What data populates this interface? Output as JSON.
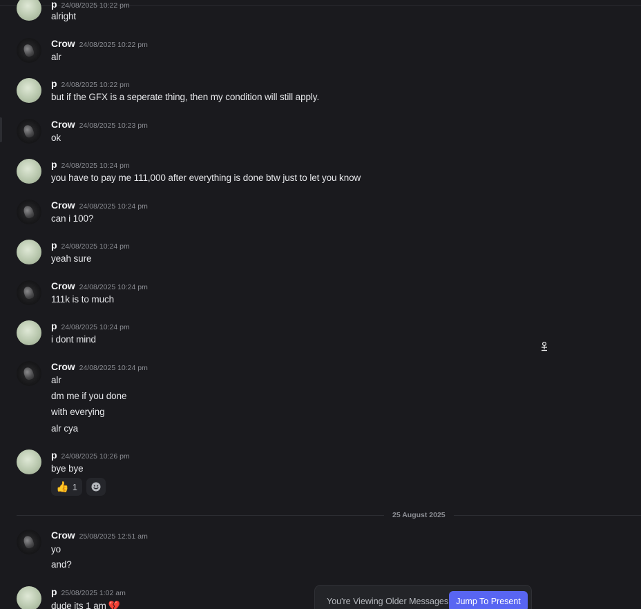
{
  "colors": {
    "background": "#1a1a1e",
    "accent": "#5865f2",
    "author_text": "#f2f3f5",
    "timestamp_text": "#8b8d93"
  },
  "messages": [
    {
      "author": "p",
      "timestamp": "24/08/2025 10:22 pm",
      "avatar": "p-avatar",
      "lines": [
        "alright"
      ]
    },
    {
      "author": "Crow",
      "timestamp": "24/08/2025 10:22 pm",
      "avatar": "crow-avatar",
      "lines": [
        "alr"
      ]
    },
    {
      "author": "p",
      "timestamp": "24/08/2025 10:22 pm",
      "avatar": "p-avatar",
      "lines": [
        "but if the GFX is a seperate thing, then my condition will still apply."
      ]
    },
    {
      "author": "Crow",
      "timestamp": "24/08/2025 10:23 pm",
      "avatar": "crow-avatar",
      "lines": [
        "ok"
      ]
    },
    {
      "author": "p",
      "timestamp": "24/08/2025 10:24 pm",
      "avatar": "p-avatar",
      "lines": [
        "you have to pay me 111,000 after everything is done btw just to let you know"
      ]
    },
    {
      "author": "Crow",
      "timestamp": "24/08/2025 10:24 pm",
      "avatar": "crow-avatar",
      "lines": [
        "can i 100?"
      ]
    },
    {
      "author": "p",
      "timestamp": "24/08/2025 10:24 pm",
      "avatar": "p-avatar",
      "lines": [
        "yeah sure"
      ]
    },
    {
      "author": "Crow",
      "timestamp": "24/08/2025 10:24 pm",
      "avatar": "crow-avatar",
      "lines": [
        "111k is to much"
      ]
    },
    {
      "author": "p",
      "timestamp": "24/08/2025 10:24 pm",
      "avatar": "p-avatar",
      "lines": [
        "i dont mind"
      ]
    },
    {
      "author": "Crow",
      "timestamp": "24/08/2025 10:24 pm",
      "avatar": "crow-avatar",
      "lines": [
        "alr",
        "dm me if you done",
        "with everying",
        "alr cya"
      ]
    },
    {
      "author": "p",
      "timestamp": "24/08/2025 10:26 pm",
      "avatar": "p-avatar",
      "lines": [
        "bye bye"
      ]
    },
    {
      "author": "Crow",
      "timestamp": "25/08/2025 12:51 am",
      "avatar": "crow-avatar",
      "lines": [
        "yo",
        "and?"
      ]
    },
    {
      "author": "p",
      "timestamp": "25/08/2025 1:02 am",
      "avatar": "p-avatar",
      "lines": [
        "dude its 1 am"
      ],
      "trailing_emoji": "💔"
    }
  ],
  "reactions": [
    {
      "emoji": "👍",
      "count": "1"
    }
  ],
  "add_reaction_icon": "add-reaction-icon",
  "date_divider": "25 August 2025",
  "older_messages_bar": {
    "text": "You're Viewing Older Messages",
    "button_label": "Jump To Present"
  }
}
